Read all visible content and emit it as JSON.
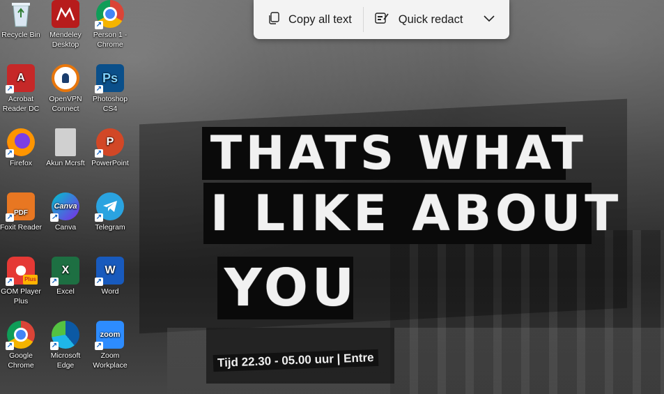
{
  "toolbar": {
    "copy_all_text": "Copy all text",
    "quick_redact": "Quick redact"
  },
  "desktop_icons": [
    {
      "label": "Recycle Bin"
    },
    {
      "label": "Mendeley Desktop"
    },
    {
      "label": "Person 1 - Chrome"
    },
    {
      "label": "Acrobat Reader DC"
    },
    {
      "label": "OpenVPN Connect"
    },
    {
      "label": "Photoshop CS4"
    },
    {
      "label": "Firefox"
    },
    {
      "label": "Akun Mcrsft"
    },
    {
      "label": "PowerPoint"
    },
    {
      "label": "Foxit Reader"
    },
    {
      "label": "Canva"
    },
    {
      "label": "Telegram"
    },
    {
      "label": "GOM Player Plus"
    },
    {
      "label": "Excel"
    },
    {
      "label": "Word"
    },
    {
      "label": "Google Chrome"
    },
    {
      "label": "Microsoft Edge"
    },
    {
      "label": "Zoom Workplace"
    }
  ],
  "icon_badges": {
    "acrobat": "A",
    "photoshop": "Ps",
    "powerpoint": "P",
    "foxit": "PDF",
    "canva": "Canva",
    "gom": "Plus",
    "excel": "X",
    "word": "W",
    "zoom": "zoom"
  },
  "wallpaper": {
    "line1": "THATS WHAT",
    "line2": "I LIKE ABOUT",
    "line3": "YOU",
    "ticket": "Tijd 22.30 - 05.00 uur | Entre"
  },
  "colors": {
    "toolbar_bg": "#f3f3f3",
    "acrobat": "#c62828",
    "powerpoint": "#d24726",
    "excel": "#1d6f42",
    "word": "#185abd",
    "zoom": "#2d8cff",
    "canva": "#7d2ae8",
    "telegram": "#2aa3e0"
  }
}
